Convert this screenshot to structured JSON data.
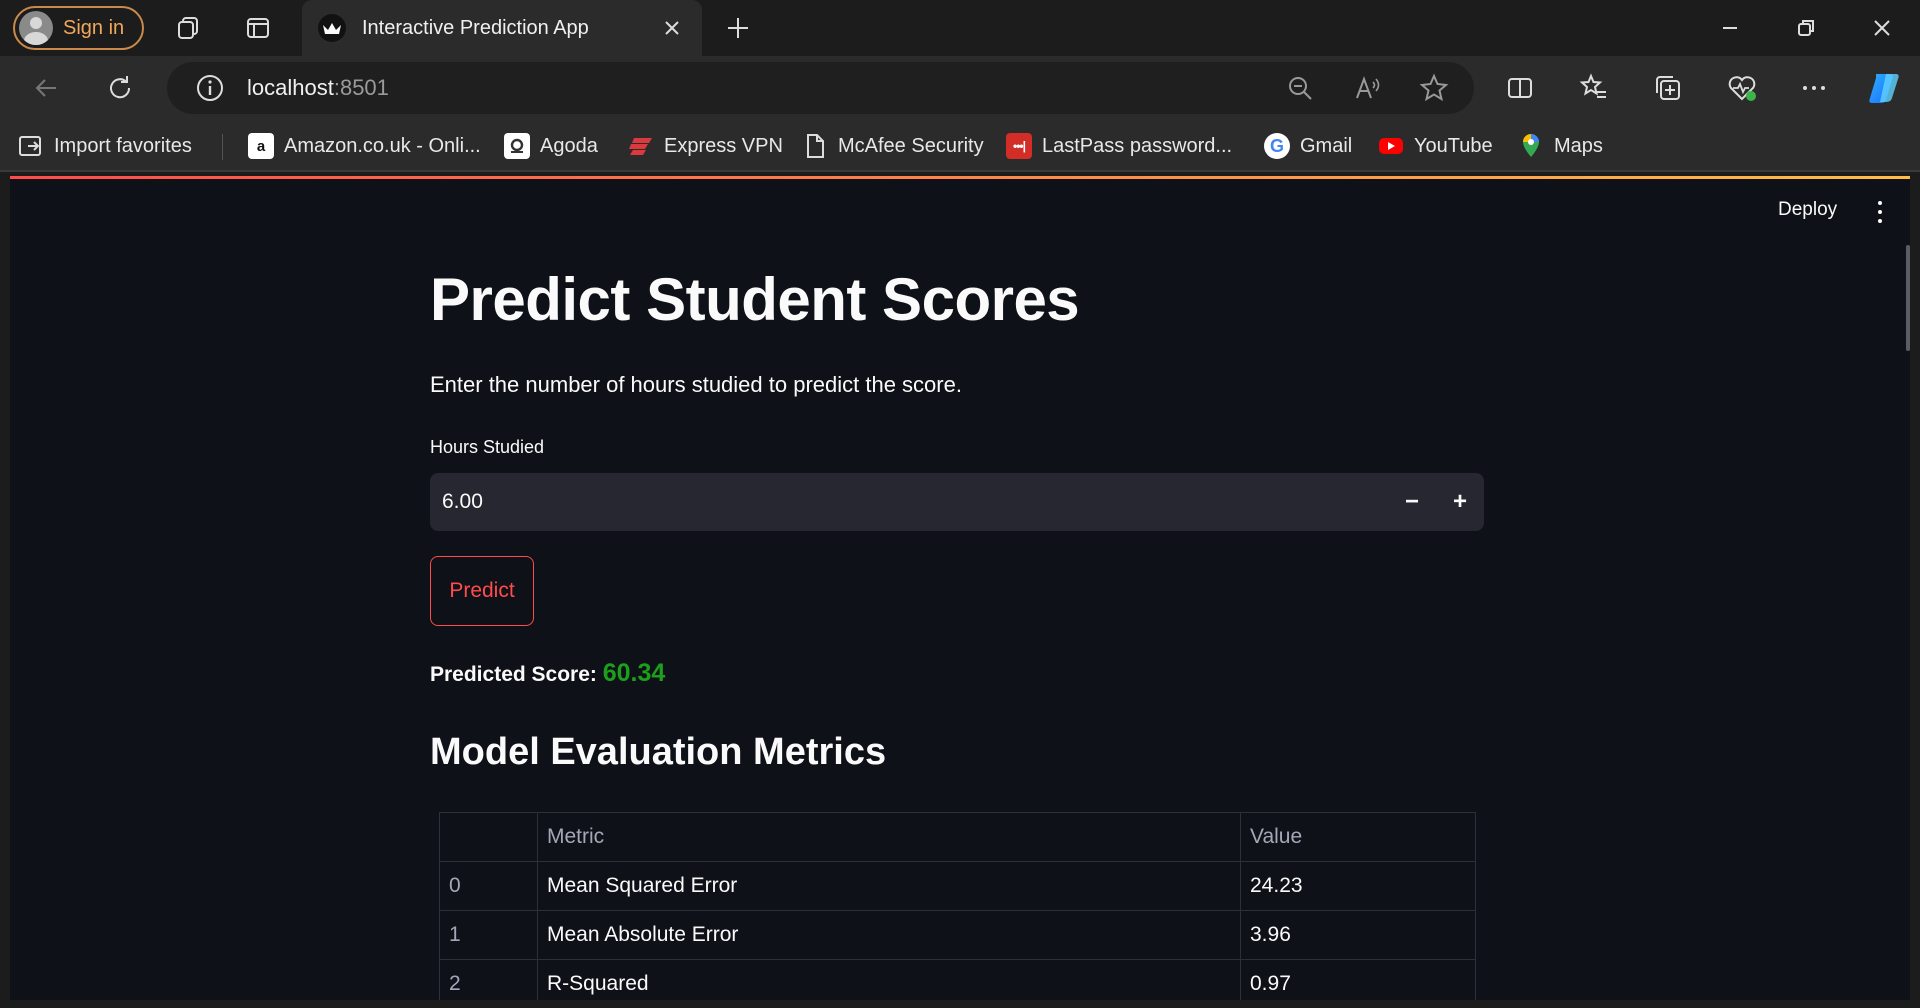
{
  "browser": {
    "sign_in_label": "Sign in",
    "tab_title": "Interactive Prediction App",
    "url_host": "localhost",
    "url_port": ":8501",
    "favorites": [
      {
        "label": "Import favorites",
        "icon": "import-icon"
      },
      {
        "label": "Amazon.co.uk - Onli...",
        "icon": "amazon-icon"
      },
      {
        "label": "Agoda",
        "icon": "agoda-icon"
      },
      {
        "label": "Express VPN",
        "icon": "expressvpn-icon"
      },
      {
        "label": "McAfee Security",
        "icon": "page-icon"
      },
      {
        "label": "LastPass password...",
        "icon": "lastpass-icon"
      },
      {
        "label": "Gmail",
        "icon": "google-icon"
      },
      {
        "label": "YouTube",
        "icon": "youtube-icon"
      },
      {
        "label": "Maps",
        "icon": "maps-icon"
      }
    ]
  },
  "app": {
    "deploy_label": "Deploy",
    "title": "Predict Student Scores",
    "subtitle": "Enter the number of hours studied to predict the score.",
    "input_label": "Hours Studied",
    "input_value": "6.00",
    "minus_label": "−",
    "plus_label": "+",
    "predict_label": "Predict",
    "result_label": "Predicted Score:",
    "result_value": "60.34",
    "metrics_title": "Model Evaluation Metrics",
    "table": {
      "headers": [
        "",
        "Metric",
        "Value"
      ],
      "rows": [
        [
          "0",
          "Mean Squared Error",
          "24.23"
        ],
        [
          "1",
          "Mean Absolute Error",
          "3.96"
        ],
        [
          "2",
          "R-Squared",
          "0.97"
        ]
      ]
    }
  },
  "colors": {
    "accent": "#ff4b4b",
    "result_green": "#1aa01a",
    "app_bg": "#0e1117"
  }
}
